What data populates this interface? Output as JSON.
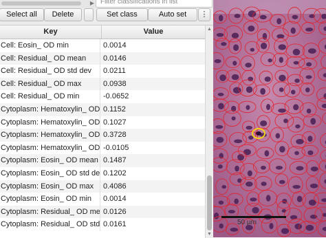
{
  "toolbar": {
    "select_all": "Select all",
    "delete": "Delete",
    "set_class": "Set class",
    "auto_set": "Auto set",
    "filter_placeholder": "Filter classifications in list",
    "more_icon": "kebab-menu-icon"
  },
  "table": {
    "headers": {
      "key": "Key",
      "value": "Value"
    },
    "rows": [
      {
        "key": "Cell: Eosin_ OD min",
        "value": "0.0014"
      },
      {
        "key": "Cell: Residual_ OD mean",
        "value": "0.0146"
      },
      {
        "key": "Cell: Residual_ OD std dev",
        "value": "0.0211"
      },
      {
        "key": "Cell: Residual_ OD max",
        "value": "0.0938"
      },
      {
        "key": "Cell: Residual_ OD min",
        "value": "-0.0652"
      },
      {
        "key": "Cytoplasm: Hematoxylin_ OD mean",
        "value": "0.1152"
      },
      {
        "key": "Cytoplasm: Hematoxylin_ OD std dev",
        "value": "0.1027"
      },
      {
        "key": "Cytoplasm: Hematoxylin_ OD max",
        "value": "0.3728"
      },
      {
        "key": "Cytoplasm: Hematoxylin_ OD min",
        "value": "-0.0105"
      },
      {
        "key": "Cytoplasm: Eosin_ OD mean",
        "value": "0.1487"
      },
      {
        "key": "Cytoplasm: Eosin_ OD std dev",
        "value": "0.1202"
      },
      {
        "key": "Cytoplasm: Eosin_ OD max",
        "value": "0.4086"
      },
      {
        "key": "Cytoplasm: Eosin_ OD min",
        "value": "0.0014"
      },
      {
        "key": "Cytoplasm: Residual_ OD mean",
        "value": "0.0126"
      },
      {
        "key": "Cytoplasm: Residual_ OD std dev",
        "value": "0.0161"
      }
    ]
  },
  "viewer": {
    "scale_label": "50 µm",
    "colors": {
      "tissue": "#b06b95",
      "outline": "#e0202a",
      "selected": "#f2d21b"
    }
  }
}
